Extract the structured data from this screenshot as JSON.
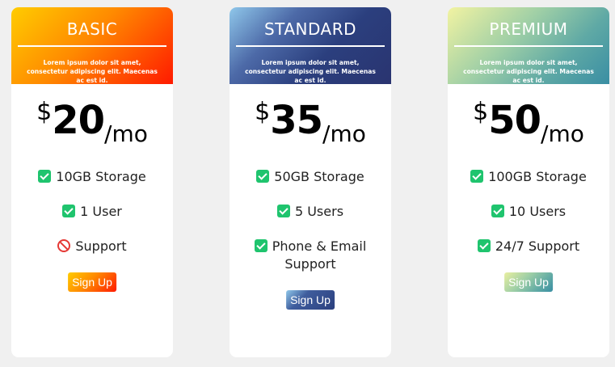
{
  "plans": [
    {
      "name": "BASIC",
      "description": "Lorem ipsum dolor sit amet, consectetur adipiscing elit. Maecenas ac est id.",
      "currency": "$",
      "amount": "20",
      "period": "/mo",
      "features": [
        {
          "label": "10GB Storage",
          "included": true
        },
        {
          "label": "1 User",
          "included": true
        },
        {
          "label": "Support",
          "included": false
        }
      ],
      "button_label": "Sign Up"
    },
    {
      "name": "STANDARD",
      "description": "Lorem ipsum dolor sit amet, consectetur adipiscing elit. Maecenas ac est id.",
      "currency": "$",
      "amount": "35",
      "period": "/mo",
      "features": [
        {
          "label": "50GB Storage",
          "included": true
        },
        {
          "label": "5 Users",
          "included": true
        },
        {
          "label": "Phone & Email",
          "label_line2": "Support",
          "included": true
        }
      ],
      "button_label": "Sign Up"
    },
    {
      "name": "PREMIUM",
      "description": "Lorem ipsum dolor sit amet, consectetur adipiscing elit. Maecenas ac est id.",
      "currency": "$",
      "amount": "50",
      "period": "/mo",
      "features": [
        {
          "label": "100GB Storage",
          "included": true
        },
        {
          "label": "10 Users",
          "included": true
        },
        {
          "label": "24/7 Support",
          "included": true
        }
      ],
      "button_label": "Sign Up"
    }
  ],
  "colors": {
    "check_green": "#1fc46e",
    "excluded_red": "#e53935",
    "basic_gradient": [
      "#ffcc00",
      "#ff1a00"
    ],
    "standard_gradient": [
      "#8fc7ea",
      "#2a3470"
    ],
    "premium_gradient": [
      "#f2f3a2",
      "#3a8ea3"
    ]
  },
  "icons": {
    "included": "check-icon",
    "excluded": "no-entry-icon"
  }
}
